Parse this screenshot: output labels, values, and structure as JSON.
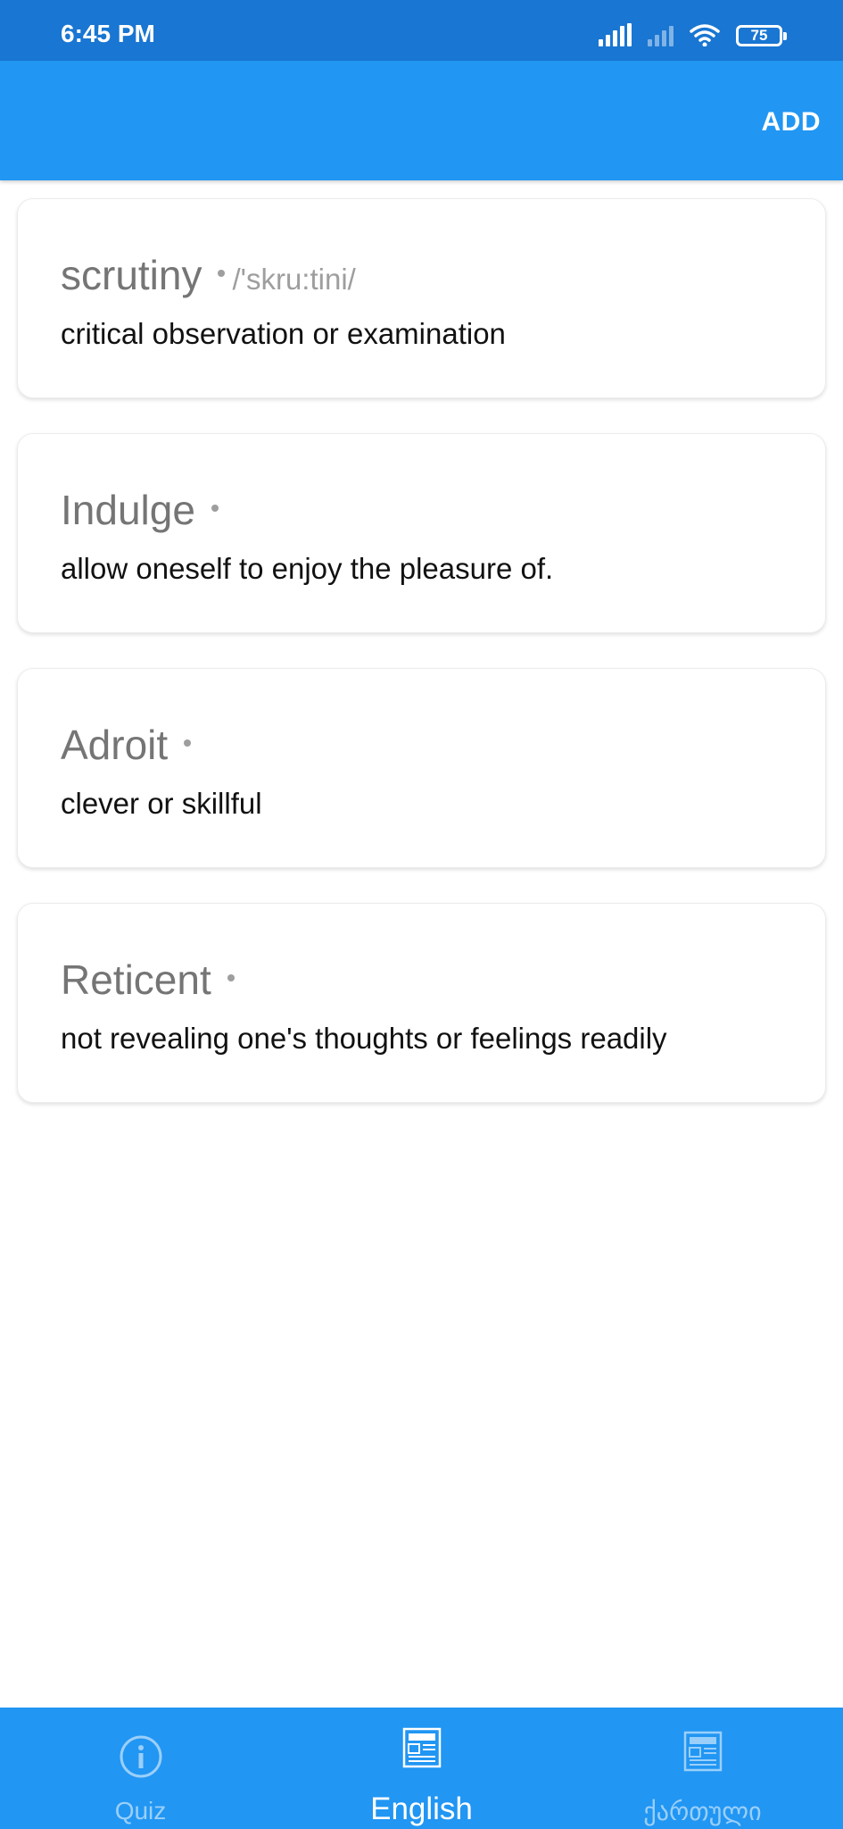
{
  "status_bar": {
    "time": "6:45 PM",
    "battery": "75",
    "icons": [
      "signal-icon",
      "signal-off-icon",
      "wifi-icon",
      "battery-icon"
    ]
  },
  "app_bar": {
    "add_label": "ADD"
  },
  "words": [
    {
      "word": "scrutiny",
      "pronunciation": "/'skru:tini/",
      "definition": "critical observation or examination"
    },
    {
      "word": "Indulge",
      "pronunciation": "",
      "definition": "allow oneself to enjoy the pleasure of."
    },
    {
      "word": "Adroit",
      "pronunciation": "",
      "definition": "clever or skillful"
    },
    {
      "word": "Reticent",
      "pronunciation": "",
      "definition": "not revealing one's thoughts or feelings readily"
    }
  ],
  "bottom_nav": {
    "items": [
      {
        "label": "Quiz",
        "icon": "info-icon",
        "active": false
      },
      {
        "label": "English",
        "icon": "dictionary-icon",
        "active": true
      },
      {
        "label": "ქართული",
        "icon": "dictionary-icon",
        "active": false
      }
    ]
  },
  "colors": {
    "status_bar": "#1976d2",
    "primary": "#2196f3",
    "word_text": "#757575",
    "definition_text": "#111111"
  }
}
